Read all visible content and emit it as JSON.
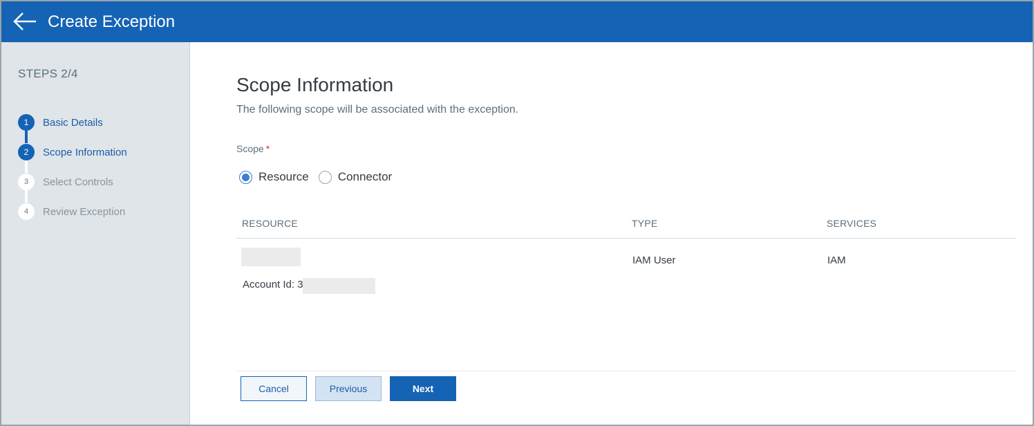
{
  "header": {
    "title": "Create Exception",
    "back_icon": "arrow-left-icon",
    "bg_color": "#1563b5"
  },
  "sidebar": {
    "steps_count": "STEPS 2/4",
    "steps": [
      {
        "number": "1",
        "label": "Basic Details",
        "state": "complete"
      },
      {
        "number": "2",
        "label": "Scope Information",
        "state": "active"
      },
      {
        "number": "3",
        "label": "Select Controls",
        "state": "pending"
      },
      {
        "number": "4",
        "label": "Review Exception",
        "state": "pending"
      }
    ]
  },
  "main": {
    "title": "Scope Information",
    "subtitle": "The following scope will be associated with the exception.",
    "scope_label": "Scope",
    "required_mark": "*",
    "scope_options": [
      {
        "label": "Resource",
        "selected": true
      },
      {
        "label": "Connector",
        "selected": false
      }
    ],
    "table": {
      "columns": [
        "RESOURCE",
        "TYPE",
        "SERVICES"
      ],
      "rows": [
        {
          "resource_account_prefix": "Account Id: 3",
          "type": "IAM User",
          "services": "IAM"
        }
      ]
    }
  },
  "footer": {
    "cancel_label": "Cancel",
    "previous_label": "Previous",
    "next_label": "Next"
  }
}
